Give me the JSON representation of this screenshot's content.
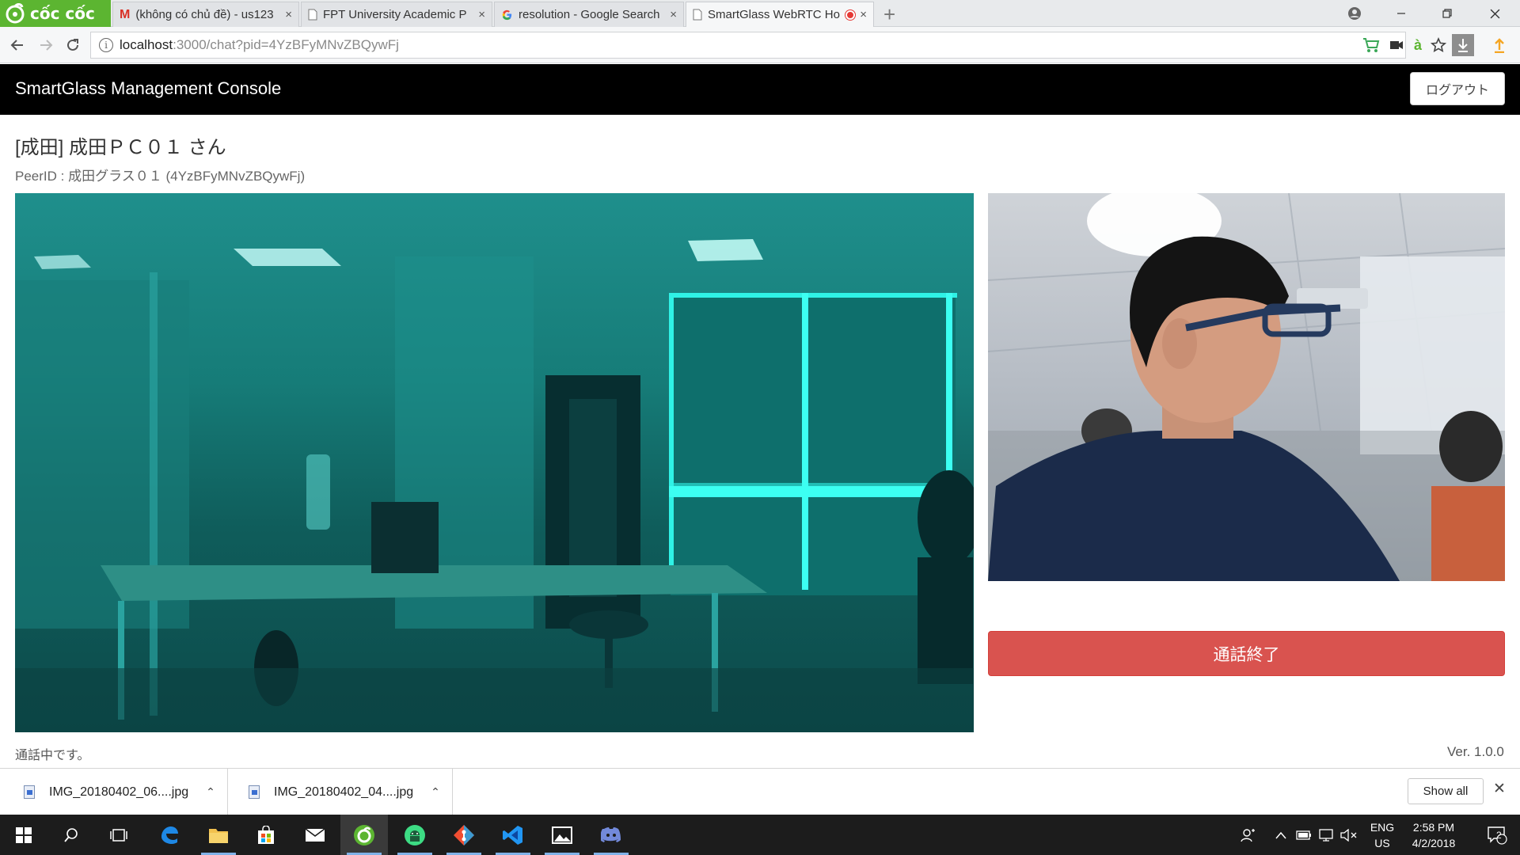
{
  "browser": {
    "brand_name": "cốc cốc",
    "tabs": [
      {
        "title": "(không có chủ đề) - us123",
        "icon": "gmail-icon",
        "active": false
      },
      {
        "title": "FPT University Academic P",
        "icon": "page-icon",
        "active": false
      },
      {
        "title": "resolution - Google Search",
        "icon": "google-icon",
        "active": false
      },
      {
        "title": "SmartGlass WebRTC Ho",
        "icon": "page-icon",
        "active": true,
        "recording": true
      }
    ],
    "close_glyph": "×",
    "new_tab_glyph": "+",
    "address": {
      "host": "localhost",
      "path": ":3000/chat?pid=4YzBFyMNvZBQywFj"
    },
    "colors": {
      "brand": "#5cb531",
      "record": "#e53935"
    }
  },
  "app": {
    "title": "SmartGlass Management Console",
    "logout_label": "ログアウト",
    "peer_title": "[成田] 成田ＰＣ０１ さん",
    "peer_id_line": "PeerID : 成田グラス０１ (4YzBFyMNvZBQywFj)",
    "end_call_label": "通話終了",
    "status_text": "通話中です。",
    "version": "Ver. 1.0.0",
    "colors": {
      "header_bg": "#000000",
      "end_call": "#d9534f"
    }
  },
  "downloads": {
    "items": [
      {
        "filename": "IMG_20180402_06....jpg"
      },
      {
        "filename": "IMG_20180402_04....jpg"
      }
    ],
    "show_all_label": "Show all",
    "close_glyph": "✕"
  },
  "taskbar": {
    "apps": [
      "start",
      "search",
      "task-view",
      "edge",
      "file-explorer",
      "store",
      "mail",
      "coccoc",
      "android-studio",
      "git",
      "vscode",
      "photos",
      "discord"
    ],
    "language_top": "ENG",
    "language_bottom": "US",
    "time": "2:58 PM",
    "date": "4/2/2018",
    "notification_count": "2"
  }
}
